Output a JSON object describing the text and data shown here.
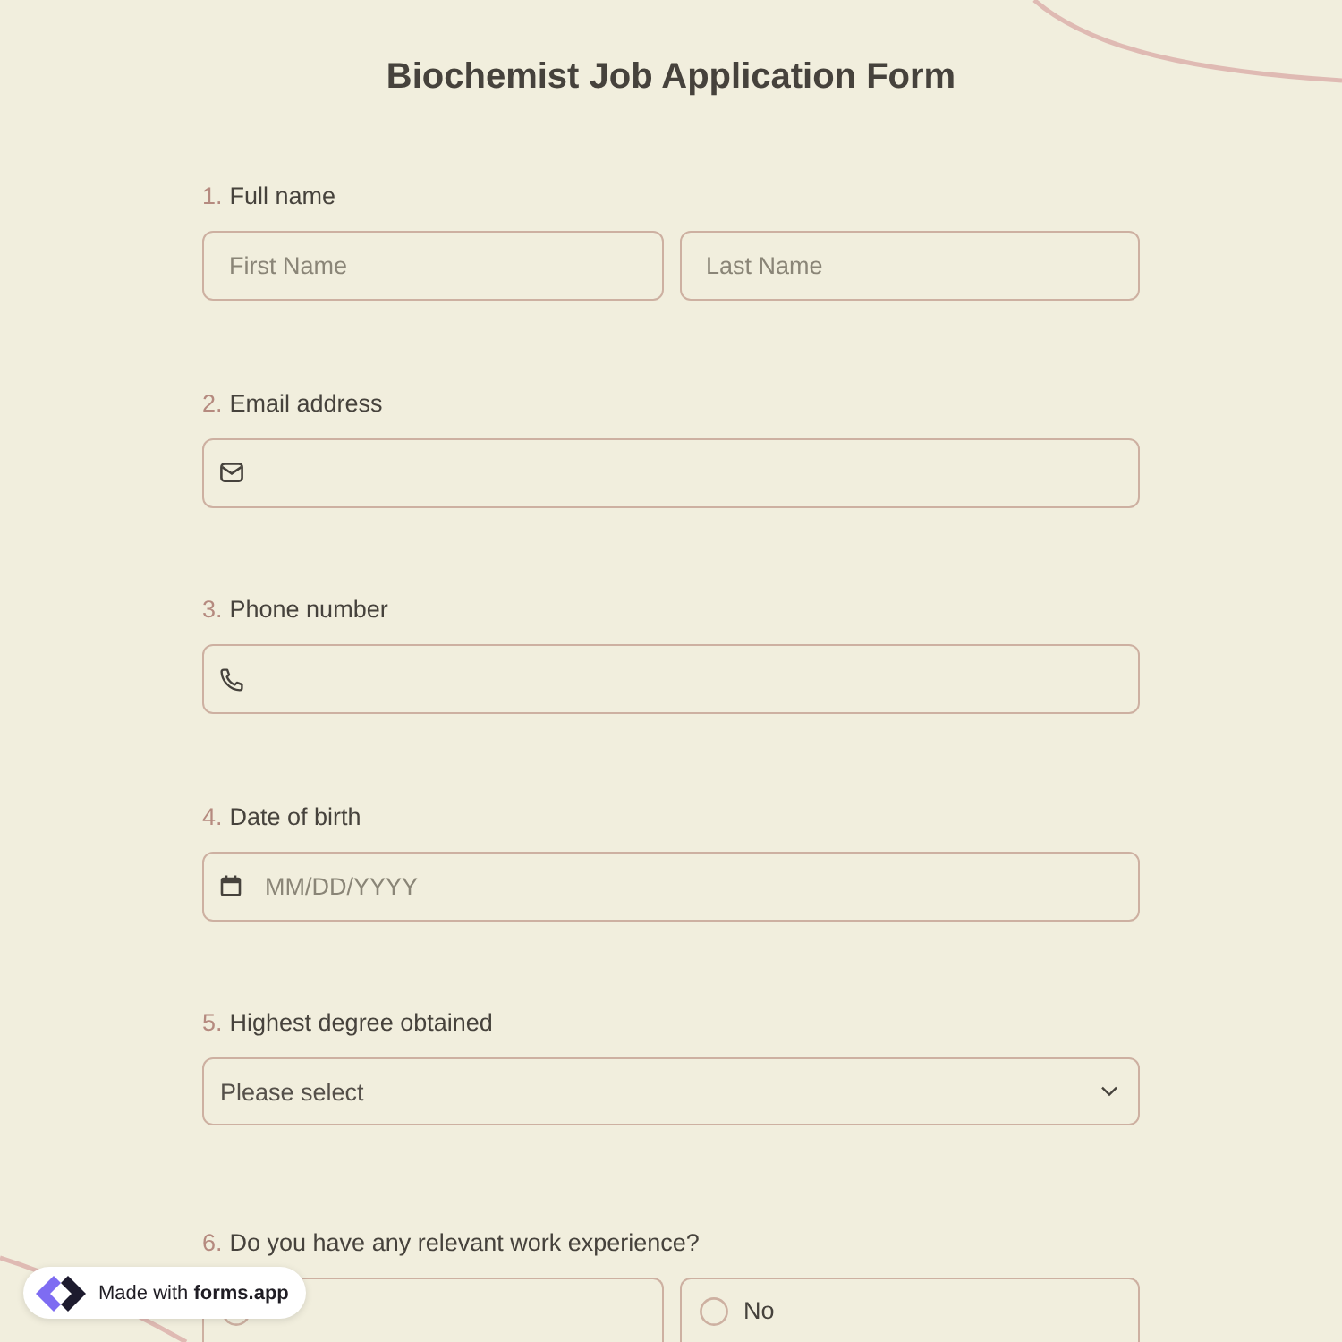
{
  "form": {
    "title": "Biochemist Job Application Form"
  },
  "questions": [
    {
      "number": "1.",
      "label": "Full name",
      "kind": "name",
      "fields": [
        {
          "placeholder": "First Name"
        },
        {
          "placeholder": "Last Name"
        }
      ]
    },
    {
      "number": "2.",
      "label": "Email address",
      "kind": "email"
    },
    {
      "number": "3.",
      "label": "Phone number",
      "kind": "phone"
    },
    {
      "number": "4.",
      "label": "Date of birth",
      "kind": "date",
      "placeholder": "MM/DD/YYYY"
    },
    {
      "number": "5.",
      "label": "Highest degree obtained",
      "kind": "select",
      "value": "Please select"
    },
    {
      "number": "6.",
      "label": "Do you have any relevant work experience?",
      "kind": "choice",
      "options": [
        {
          "selected": false
        },
        {
          "label": "No",
          "selected": false
        }
      ]
    }
  ],
  "badge": {
    "text": "Made with **forms.app**"
  }
}
